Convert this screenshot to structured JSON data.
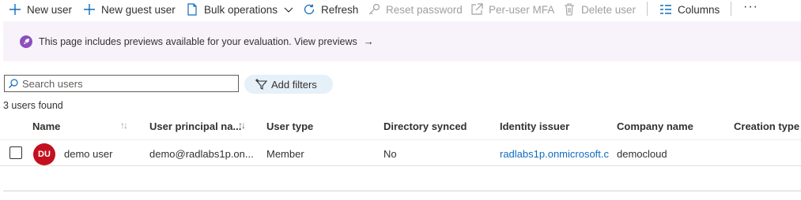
{
  "toolbar": {
    "new_user": "New user",
    "new_guest_user": "New guest user",
    "bulk_operations": "Bulk operations",
    "refresh": "Refresh",
    "reset_password": "Reset password",
    "per_user_mfa": "Per-user MFA",
    "delete_user": "Delete user",
    "columns": "Columns",
    "more": "···"
  },
  "banner": {
    "message": "This page includes previews available for your evaluation. View previews",
    "arrow": "→"
  },
  "search": {
    "placeholder": "Search users"
  },
  "filters": {
    "add_filters_label": "Add filters"
  },
  "results": {
    "count_text": "3 users found"
  },
  "table": {
    "columns": {
      "name": "Name",
      "upn": "User principal na...",
      "user_type": "User type",
      "directory_synced": "Directory synced",
      "identity_issuer": "Identity issuer",
      "company_name": "Company name",
      "creation_type": "Creation type"
    },
    "sort_glyph": "↑↓",
    "rows": [
      {
        "initials": "DU",
        "name": "demo user",
        "upn": "demo@radlabs1p.on...",
        "user_type": "Member",
        "directory_synced": "No",
        "identity_issuer": "radlabs1p.onmicrosoft.c",
        "company_name": "democloud",
        "creation_type": ""
      }
    ]
  },
  "colors": {
    "accent": "#0f6cbd",
    "avatar_bg": "#c50f1f",
    "banner_bg": "#f8f3fb",
    "rocket_bg": "#8c4fbf",
    "disabled_text": "#a19f9d",
    "filter_pill_bg": "#e6f0f8"
  },
  "icons": {
    "new_user": "plus-icon",
    "new_guest_user": "plus-icon",
    "bulk_operations": "document-icon",
    "bulk_dropdown": "chevron-down-icon",
    "refresh": "refresh-icon",
    "reset_password": "key-icon",
    "per_user_mfa": "external-link-icon",
    "delete_user": "trash-icon",
    "columns": "columns-icon",
    "banner": "rocket-icon",
    "search": "search-icon",
    "add_filters": "filter-add-icon"
  }
}
